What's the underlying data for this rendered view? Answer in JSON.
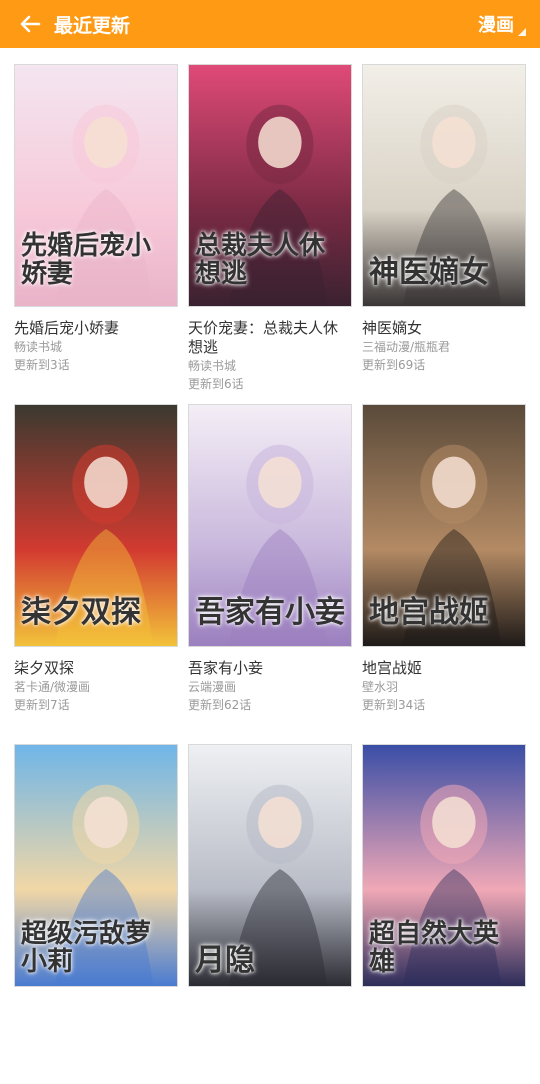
{
  "header": {
    "title": "最近更新",
    "category": "漫画"
  },
  "books": [
    {
      "title": "先婚后宠小娇妻",
      "author": "畅读书城",
      "update": "更新到3话",
      "cover_text": "先婚后宠小娇妻",
      "palette": [
        "#f3e6f0",
        "#f7c9d9",
        "#e9b3c8"
      ]
    },
    {
      "title": "天价宠妻：总裁夫人休想逃",
      "author": "畅读书城",
      "update": "更新到6话",
      "cover_text": "总裁夫人休想逃",
      "palette": [
        "#e04a78",
        "#7a2a44",
        "#3a2230"
      ]
    },
    {
      "title": "神医嫡女",
      "author": "三福动漫/瓶瓶君",
      "update": "更新到69话",
      "cover_text": "神医嫡女",
      "palette": [
        "#f2efe8",
        "#d9d2c6",
        "#3a3636"
      ]
    },
    {
      "title": "柒夕双探",
      "author": "茗卡通/微漫画",
      "update": "更新到7话",
      "cover_text": "柒夕双探",
      "palette": [
        "#3b3a30",
        "#d23a30",
        "#f3c23a"
      ]
    },
    {
      "title": "吾家有小妾",
      "author": "云端漫画",
      "update": "更新到62话",
      "cover_text": "吾家有小妾",
      "palette": [
        "#f4eef6",
        "#c8b7dc",
        "#9b7fbf"
      ]
    },
    {
      "title": "地宫战姬",
      "author": "壁水羽",
      "update": "更新到34话",
      "cover_text": "地宫战姬",
      "palette": [
        "#5a4a3a",
        "#b38a64",
        "#1e1a18"
      ]
    },
    {
      "title": "",
      "author": "",
      "update": "",
      "cover_text": "超级污敌萝小莉",
      "palette": [
        "#6fb6e8",
        "#f1d7a6",
        "#4a7bd1"
      ]
    },
    {
      "title": "",
      "author": "",
      "update": "",
      "cover_text": "月隐",
      "palette": [
        "#eef0f3",
        "#b8bcc6",
        "#2b2b33"
      ]
    },
    {
      "title": "",
      "author": "",
      "update": "",
      "cover_text": "超自然大英雄",
      "palette": [
        "#3a4ea6",
        "#f0a8b6",
        "#2d2d5a"
      ]
    }
  ]
}
